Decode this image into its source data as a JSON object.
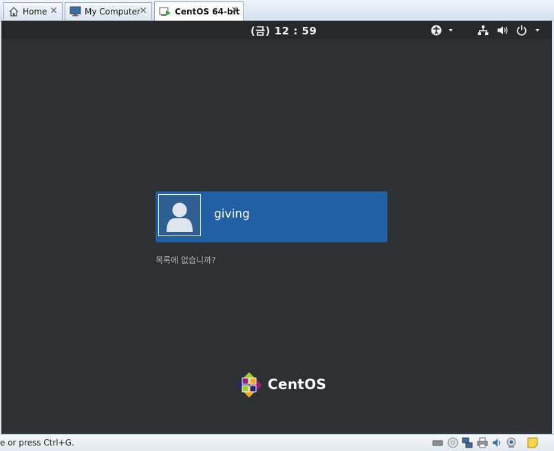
{
  "tabs": [
    {
      "label": "Home",
      "icon": "home-icon"
    },
    {
      "label": "My Computer",
      "icon": "computer-icon"
    },
    {
      "label": "CentOS 64-bit",
      "icon": "vm-running-icon",
      "active": true
    }
  ],
  "guest": {
    "clock": "(금) 12 : 59",
    "topbar_icons": [
      "accessibility-icon",
      "network-icon",
      "volume-icon",
      "power-icon"
    ],
    "user": {
      "name": "giving"
    },
    "not_listed": "목록에 없습니까?",
    "logo_text": "CentOS",
    "colors": {
      "background": "#2e3134",
      "user_box": "#2160a4",
      "topbar": "#26292b"
    }
  },
  "statusbar": {
    "text": "e or press Ctrl+G.",
    "icons": [
      "hard-disk-icon",
      "cd-rom-icon",
      "network-adapter-icon",
      "printer-icon",
      "sound-icon",
      "webcam-icon",
      "message-log-icon"
    ]
  }
}
